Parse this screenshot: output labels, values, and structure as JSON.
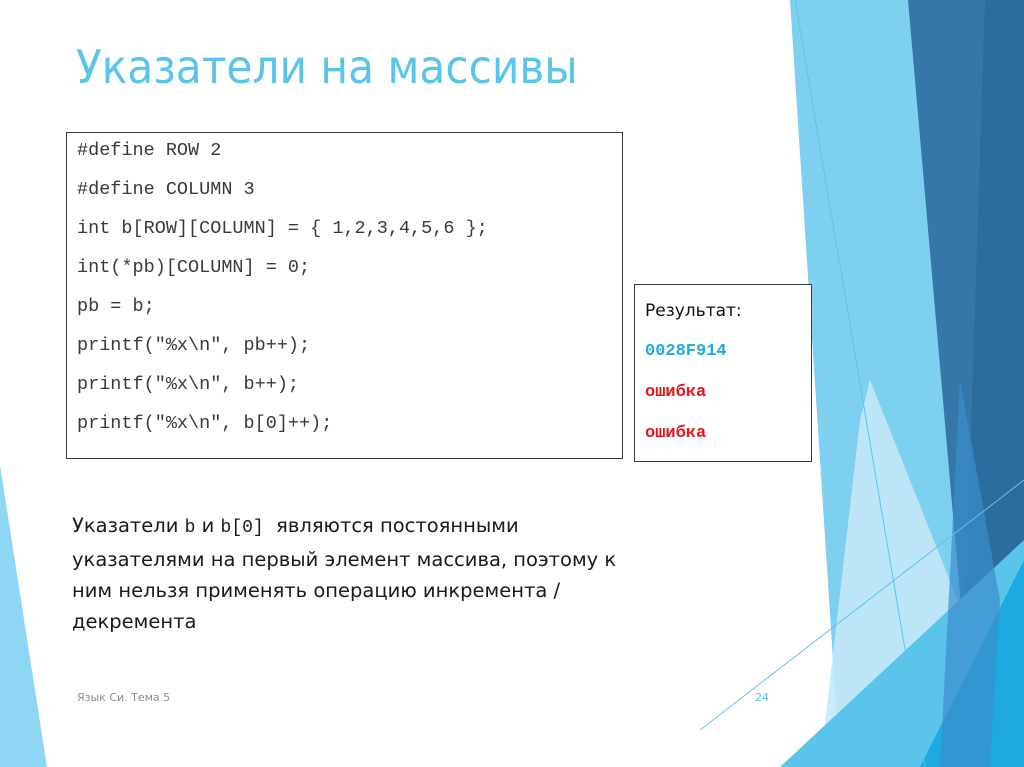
{
  "slide": {
    "title": "Указатели на массивы",
    "code_lines": [
      "#define ROW 2",
      "#define COLUMN 3",
      "int b[ROW][COLUMN] = { 1,2,3,4,5,6 };",
      "int(*pb)[COLUMN] = 0;",
      "pb = b;",
      "printf(\"%x\\n\", pb++);",
      "printf(\"%x\\n\", b++);",
      "printf(\"%x\\n\", b[0]++);"
    ],
    "result": {
      "label": "Результат:",
      "lines": [
        {
          "text": "0028F914",
          "color": "#1ea9e1"
        },
        {
          "text": "ошибка",
          "color": "#e8141b"
        },
        {
          "text": "ошибка",
          "color": "#e8141b"
        }
      ]
    },
    "explanation": {
      "part1": "Указатели ",
      "code1": "b",
      "part2": " и ",
      "code2": "b[0]",
      "part3": "  являются постоянными",
      "line2": "указателями на первый элемент массива, поэтому к",
      "line3": "ним нельзя применять операцию инкремента /",
      "line4": "декремента"
    },
    "footer": {
      "left": "Язык Си. Тема 5",
      "page_number": "24"
    }
  },
  "theme": {
    "accent": "#5bc4ea",
    "dark_blue": "#2a6b9e",
    "mid_blue": "#3577a8",
    "light_blue": "#7dd0f0",
    "bright_blue": "#1ea9e1"
  }
}
